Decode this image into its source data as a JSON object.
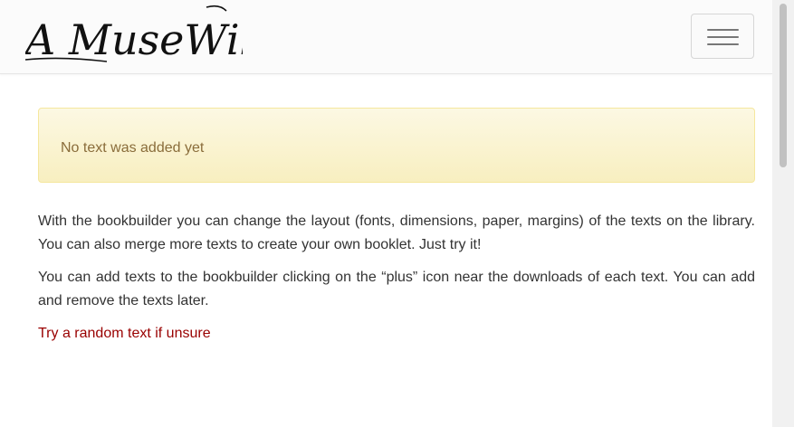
{
  "header": {
    "logo_text": "A MuseWiki",
    "menu_toggle_icon": "hamburger-menu-icon"
  },
  "alert": {
    "message": "No text was added yet",
    "background": "#fcf8e3",
    "text_color": "#8a6d3b"
  },
  "intro": {
    "paragraph1": "With the bookbuilder you can change the layout (fonts, dimensions, paper, margins) of the texts on the library. You can also merge more texts to create your own booklet. Just try it!",
    "paragraph2": "You can add texts to the bookbuilder clicking on the “plus” icon near the downloads of each text. You can add and remove the texts later.",
    "random_link": "Try a random text if unsure",
    "link_color": "#990000"
  }
}
